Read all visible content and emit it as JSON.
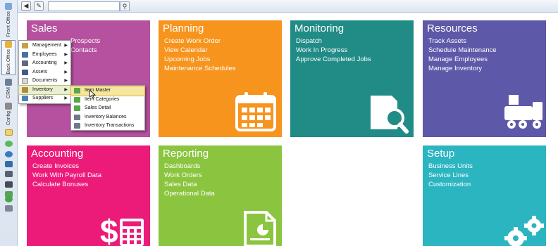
{
  "sidebar": {
    "tabs": [
      {
        "label": "Front Office"
      },
      {
        "label": "Back Office"
      },
      {
        "label": "CRM"
      },
      {
        "label": "Config"
      }
    ],
    "icons": [
      "page-icon",
      "cog-green-icon",
      "globe-icon",
      "puzzle-icon",
      "phone-icon",
      "printer-icon",
      "drive-icon",
      "power-icon",
      "mail-icon"
    ]
  },
  "toolbar": {
    "back_glyph": "◀",
    "pin_glyph": "✎",
    "search_value": "",
    "search_glyph": "⚲"
  },
  "tiles": {
    "sales": {
      "title": "Sales",
      "color": "#b5519e",
      "links": [
        "Prospects",
        "Contacts"
      ]
    },
    "planning": {
      "title": "Planning",
      "color": "#f7941d",
      "links": [
        "Create Work Order",
        "View Calendar",
        "Upcoming Jobs",
        "Maintenance Schedules"
      ]
    },
    "monitoring": {
      "title": "Monitoring",
      "color": "#218b85",
      "links": [
        "Dispatch",
        "Work In Progress",
        "Approve Completed Jobs"
      ]
    },
    "resources": {
      "title": "Resources",
      "color": "#5e58a8",
      "links": [
        "Track Assets",
        "Schedule Maintenance",
        "Manage Employees",
        "Manage Inventory"
      ]
    },
    "accounting": {
      "title": "Accounting",
      "color": "#ec1b7a",
      "links": [
        "Create Invoices",
        "Work With Payroll Data",
        "Calculate Bonuses"
      ]
    },
    "reporting": {
      "title": "Reporting",
      "color": "#8bc53f",
      "links": [
        "Dashboards",
        "Work Orders",
        "Sales Data",
        "Operational Data"
      ]
    },
    "setup": {
      "title": "Setup",
      "color": "#2bb5c1",
      "links": [
        "Business Units",
        "Service Lines",
        "Customization"
      ]
    }
  },
  "menu": {
    "items": [
      {
        "label": "Management",
        "icon": "management-icon"
      },
      {
        "label": "Employees",
        "icon": "employees-icon"
      },
      {
        "label": "Accounting",
        "icon": "accounting-icon"
      },
      {
        "label": "Assets",
        "icon": "assets-icon"
      },
      {
        "label": "Documents",
        "icon": "documents-icon"
      },
      {
        "label": "Inventory",
        "icon": "inventory-icon"
      },
      {
        "label": "Suppliers",
        "icon": "suppliers-icon"
      }
    ],
    "submenu": [
      {
        "label": "Item Master"
      },
      {
        "label": "Item Categories"
      },
      {
        "label": "Sales Detail"
      },
      {
        "label": "Inventory Balances"
      },
      {
        "label": "Inventory Transactions"
      }
    ],
    "arrow_glyph": "▶"
  }
}
